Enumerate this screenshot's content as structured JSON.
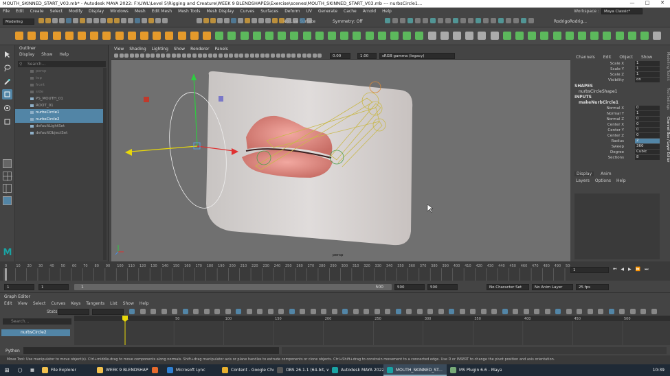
{
  "titlebar": {
    "text": "MOUTH_SKINNED_START_V03.mb* - Autodesk MAYA 2022: F:\\UWL\\Level 5\\Rigging and Creature\\WEEK 9 BLENDSHAPES\\Exercise\\scenes\\MOUTH_SKINNED_START_V03.mb  ---  nurbsCircle1..."
  },
  "menu": [
    "File",
    "Edit",
    "Create",
    "Select",
    "Modify",
    "Display",
    "Windows",
    "Mesh",
    "Edit Mesh",
    "Mesh Tools",
    "Mesh Display",
    "Curves",
    "Surfaces",
    "Deform",
    "UV",
    "Generate",
    "Cache",
    "Arnold",
    "Help"
  ],
  "workspace": {
    "label": "Workspace :",
    "value": "Maya Classic*"
  },
  "statusline": {
    "menuset": "Modeling",
    "live_surface": "No Live Surface",
    "symmetry": "Symmetry: Off",
    "user": "RodrigoRodrig..."
  },
  "outliner": {
    "title": "Outliner",
    "menu": [
      "Display",
      "Show",
      "Help"
    ],
    "search_placeholder": "Search...",
    "items": [
      {
        "label": "persp",
        "state": "dim"
      },
      {
        "label": "top",
        "state": "dim"
      },
      {
        "label": "front",
        "state": "dim"
      },
      {
        "label": "side",
        "state": "dim"
      },
      {
        "label": "PS_MOUTH_01",
        "state": "normal"
      },
      {
        "label": "ROOT_01",
        "state": "normal"
      },
      {
        "label": "nurbsCircle1",
        "state": "sel"
      },
      {
        "label": "nurbsCircle2",
        "state": "sel"
      },
      {
        "label": "defaultLightSet",
        "state": "normal"
      },
      {
        "label": "defaultObjectSet",
        "state": "normal"
      }
    ]
  },
  "viewport": {
    "menu": [
      "View",
      "Shading",
      "Lighting",
      "Show",
      "Renderer",
      "Panels"
    ],
    "field1": "0.00",
    "field2": "1.00",
    "colorspace": "sRGB gamma (legacy)",
    "camera_label": "persp"
  },
  "channelbox": {
    "menu": [
      "Channels",
      "Edit",
      "Object",
      "Show"
    ],
    "top_channels": [
      {
        "name": "Scale X",
        "value": "1"
      },
      {
        "name": "Scale Y",
        "value": "1"
      },
      {
        "name": "Scale Z",
        "value": "1"
      },
      {
        "name": "Visibility",
        "value": "on"
      }
    ],
    "shapes_header": "SHAPES",
    "shape_name": "nurbsCircleShape1",
    "inputs_header": "INPUTS",
    "input_name": "makeNurbCircle1",
    "input_channels": [
      {
        "name": "Normal X",
        "value": "0"
      },
      {
        "name": "Normal Y",
        "value": "1"
      },
      {
        "name": "Normal Z",
        "value": "0"
      },
      {
        "name": "Center X",
        "value": "0"
      },
      {
        "name": "Center Y",
        "value": "0"
      },
      {
        "name": "Center Z",
        "value": "0"
      },
      {
        "name": "Radius",
        "value": "2"
      },
      {
        "name": "Sweep",
        "value": "360"
      },
      {
        "name": "Degree",
        "value": "Cubic"
      },
      {
        "name": "Sections",
        "value": "8"
      }
    ],
    "layer_tabs": [
      "Display",
      "Anim"
    ],
    "layer_menu": [
      "Layers",
      "Options",
      "Help"
    ],
    "side_tabs": [
      "Modelling Toolkit",
      "Tool Settings",
      "Channel Box / Layer Editor"
    ]
  },
  "timeline": {
    "ticks": [
      "0",
      "10",
      "20",
      "30",
      "40",
      "50",
      "60",
      "70",
      "80",
      "90",
      "100",
      "110",
      "120",
      "130",
      "140",
      "150",
      "160",
      "170",
      "180",
      "190",
      "200",
      "210",
      "220",
      "230",
      "240",
      "250",
      "260",
      "270",
      "280",
      "290",
      "300",
      "310",
      "320",
      "330",
      "340",
      "350",
      "360",
      "370",
      "380",
      "390",
      "400",
      "410",
      "420",
      "430",
      "440",
      "450",
      "460",
      "470",
      "480",
      "490",
      "500"
    ],
    "current_frame": "1"
  },
  "range": {
    "start": "1",
    "start2": "1",
    "slider_label": "1",
    "slider_end": "500",
    "end": "500",
    "end2": "500",
    "character_set": "No Character Set",
    "anim_layer": "No Anim Layer",
    "fps": "25 fps"
  },
  "grapheditor": {
    "title": "Graph Editor",
    "menu": [
      "Edit",
      "View",
      "Select",
      "Curves",
      "Keys",
      "Tangents",
      "List",
      "Show",
      "Help"
    ],
    "stats_label": "Stats",
    "search_placeholder": "Search...",
    "curve_item": "nurbsCircle2",
    "ticks": [
      "1",
      "50",
      "100",
      "150",
      "200",
      "250",
      "300",
      "350",
      "400",
      "450",
      "500"
    ],
    "current_frame": "1"
  },
  "python": {
    "label": "Python"
  },
  "helpline": {
    "text": "Move Tool: Use manipulator to move object(s). Ctrl+middle-drag to move components along normals. Shift+drag manipulator axis or plane handles to extrude components or clone objects. Ctrl+Shift+drag to constrain movement to a connected edge. Use D or INSERT to change the pivot position and axis orientation."
  },
  "taskbar": {
    "items": [
      {
        "label": "File Explorer",
        "color": "#f2c14e"
      },
      {
        "label": "WEEK 9 BLENDSHAPES",
        "color": "#f2c14e"
      },
      {
        "label": "",
        "color": "#e66a2c"
      },
      {
        "label": "Microsoft Lync",
        "color": "#2f7fd1"
      },
      {
        "label": "Content - Google Chr...",
        "color": "#e8b02d"
      },
      {
        "label": "OBS 26.1.1 (64-bit, wi...",
        "color": "#555"
      },
      {
        "label": "Autodesk MAYA 2022...",
        "color": "#1aa3a3"
      },
      {
        "label": "MOUTH_SKINNED_ST...",
        "color": "#1aa3a3"
      },
      {
        "label": "MS Plugin 6.6 - Maya",
        "color": "#7a7"
      }
    ],
    "clock": "10:39"
  },
  "colors": {
    "selection": "#5285a6",
    "maya_bg": "#444444",
    "viewport_bg": "#707070"
  }
}
